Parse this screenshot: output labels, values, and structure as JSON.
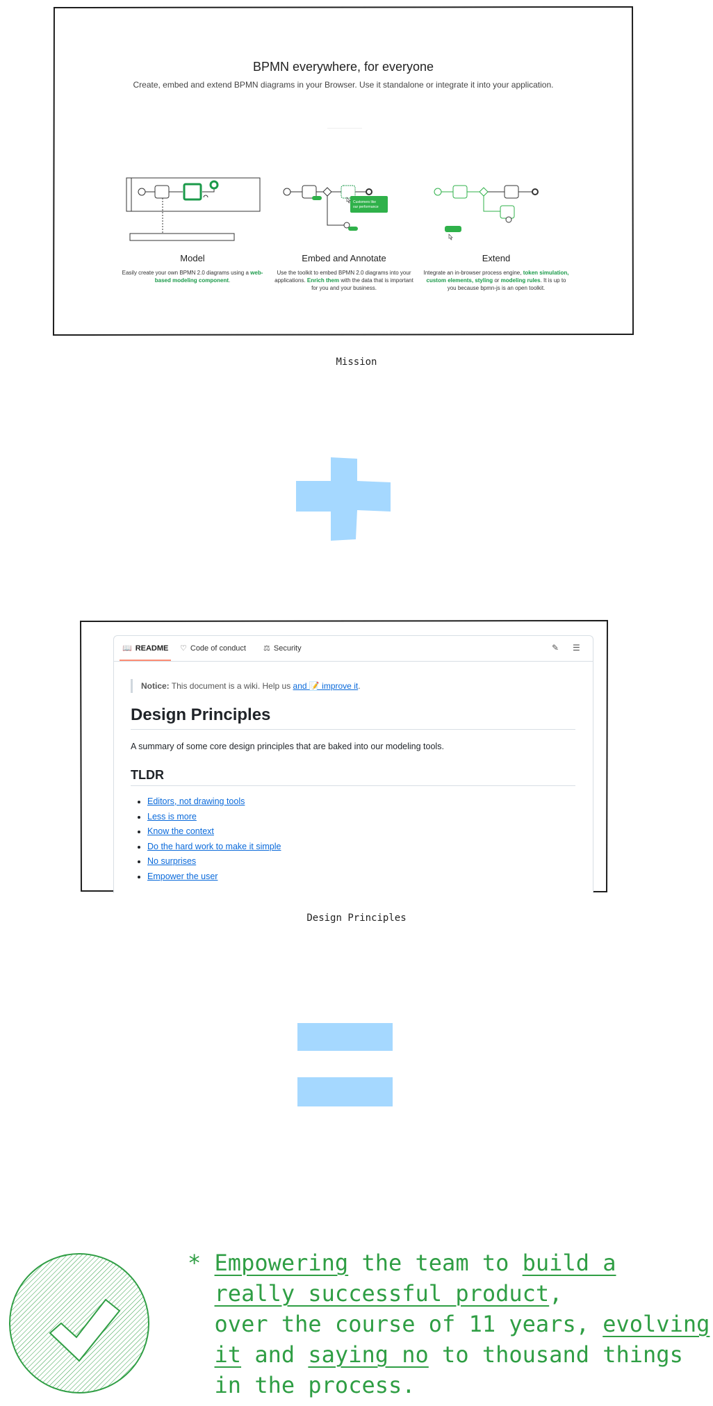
{
  "mission": {
    "title": "BPMN everywhere, for everyone",
    "subtitle": "Create, embed and extend BPMN diagrams in your Browser. Use it standalone or integrate it into your application.",
    "features": [
      {
        "title": "Model",
        "desc_parts": [
          "Easily create your own BPMN 2.0 diagrams using a ",
          "web-based modeling component",
          "."
        ]
      },
      {
        "title": "Embed and Annotate",
        "desc_parts": [
          "Use the toolkit to embed BPMN 2.0 diagrams into your applications. ",
          "Enrich them",
          " with the data that is important for you and your business."
        ]
      },
      {
        "title": "Extend",
        "desc_parts": [
          "Integrate an in-browser process engine, ",
          "token simulation, custom elements, styling",
          " or ",
          "modeling rules",
          ". It is up to you because bpmn-js is an open toolkit."
        ]
      }
    ],
    "tooltip_line1": "Customers like",
    "tooltip_line2": "our performance",
    "caption": "Mission"
  },
  "design_principles": {
    "tabs": [
      {
        "label": "README",
        "icon": "book-icon"
      },
      {
        "label": "Code of conduct",
        "icon": "heart-icon"
      },
      {
        "label": "Security",
        "icon": "scale-icon"
      }
    ],
    "notice_label": "Notice:",
    "notice_text": "This document is a wiki. Help us",
    "notice_link": "and 📝 improve it",
    "notice_end": ".",
    "heading": "Design Principles",
    "summary": "A summary of some core design principles that are baked into our modeling tools.",
    "tldr": "TLDR",
    "items": [
      "Editors, not drawing tools",
      "Less is more",
      "Know the context",
      "Do the hard work to make it simple",
      "No surprises",
      "Empower the user"
    ],
    "caption": "Design Principles"
  },
  "result": {
    "bullet": "*",
    "parts": [
      {
        "text": "Empowering",
        "u": true
      },
      {
        "text": " the team to ",
        "u": false
      },
      {
        "text": "build a",
        "u": true
      },
      {
        "text": "\n  ",
        "u": false
      },
      {
        "text": "really successful product",
        "u": true
      },
      {
        "text": ",\n  over the course of 11 years, ",
        "u": false
      },
      {
        "text": "evolving",
        "u": true
      },
      {
        "text": "\n  ",
        "u": false
      },
      {
        "text": "it",
        "u": true
      },
      {
        "text": " and ",
        "u": false
      },
      {
        "text": "saying no",
        "u": true
      },
      {
        "text": " to thousand things\n  in the process.",
        "u": false
      }
    ]
  },
  "colors": {
    "accent_green": "#2f9e44",
    "bpmn_green": "#1b9a4a",
    "blue_shape": "#a5d8ff",
    "link_blue": "#0969da"
  }
}
